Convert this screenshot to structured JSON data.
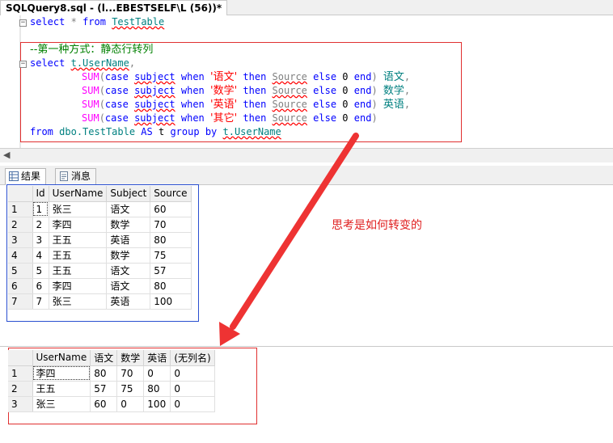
{
  "window": {
    "tab_title": "SQLQuery8.sql - (l...EBESTSELF\\L (56))*"
  },
  "editor": {
    "line1": {
      "kw_select": "select",
      "star": "*",
      "kw_from": "from",
      "table": "TestTable"
    },
    "comment": "--第一种方式：静态行转列",
    "line3": {
      "kw_select": "select",
      "col": "t.UserName",
      "comma": ","
    },
    "sum_rows": [
      {
        "fn": "SUM",
        "open": "(",
        "kw_case": "case",
        "col": "subject",
        "kw_when": "when",
        "value": "'语文'",
        "kw_then": "then",
        "src": "Source",
        "kw_else": "else",
        "zero": "0",
        "kw_end": "end",
        "close": ")",
        "alias": "语文",
        "tail": ","
      },
      {
        "fn": "SUM",
        "open": "(",
        "kw_case": "case",
        "col": "subject",
        "kw_when": "when",
        "value": "'数学'",
        "kw_then": "then",
        "src": "Source",
        "kw_else": "else",
        "zero": "0",
        "kw_end": "end",
        "close": ")",
        "alias": "数学",
        "tail": ","
      },
      {
        "fn": "SUM",
        "open": "(",
        "kw_case": "case",
        "col": "subject",
        "kw_when": "when",
        "value": "'英语'",
        "kw_then": "then",
        "src": "Source",
        "kw_else": "else",
        "zero": "0",
        "kw_end": "end",
        "close": ")",
        "alias": "英语",
        "tail": ","
      },
      {
        "fn": "SUM",
        "open": "(",
        "kw_case": "case",
        "col": "subject",
        "kw_when": "when",
        "value": "'其它'",
        "kw_then": "then",
        "src": "Source",
        "kw_else": "else",
        "zero": "0",
        "kw_end": "end",
        "close": ")",
        "alias": "",
        "tail": ""
      }
    ],
    "last": {
      "kw_from": "from",
      "table": "dbo.TestTable",
      "kw_as": "AS",
      "alias": "t",
      "kw_group": "group",
      "kw_by": "by",
      "col": "t.UserName"
    }
  },
  "results_tabs": {
    "results": "结果",
    "messages": "消息"
  },
  "grid1": {
    "headers": [
      "Id",
      "UserName",
      "Subject",
      "Source"
    ],
    "rows": [
      [
        "1",
        "1",
        "张三",
        "语文",
        "60"
      ],
      [
        "2",
        "2",
        "李四",
        "数学",
        "70"
      ],
      [
        "3",
        "3",
        "王五",
        "英语",
        "80"
      ],
      [
        "4",
        "4",
        "王五",
        "数学",
        "75"
      ],
      [
        "5",
        "5",
        "王五",
        "语文",
        "57"
      ],
      [
        "6",
        "6",
        "李四",
        "语文",
        "80"
      ],
      [
        "7",
        "7",
        "张三",
        "英语",
        "100"
      ]
    ]
  },
  "annotation": "思考是如何转变的",
  "grid2": {
    "headers": [
      "UserName",
      "语文",
      "数学",
      "英语",
      "(无列名)"
    ],
    "rows": [
      [
        "1",
        "李四",
        "80",
        "70",
        "0",
        "0"
      ],
      [
        "2",
        "王五",
        "57",
        "75",
        "80",
        "0"
      ],
      [
        "3",
        "张三",
        "60",
        "0",
        "100",
        "0"
      ]
    ]
  },
  "colors": {
    "highlight_box": "#e03030",
    "grid_box": "#2a4fd0",
    "arrow": "#ee3333"
  }
}
